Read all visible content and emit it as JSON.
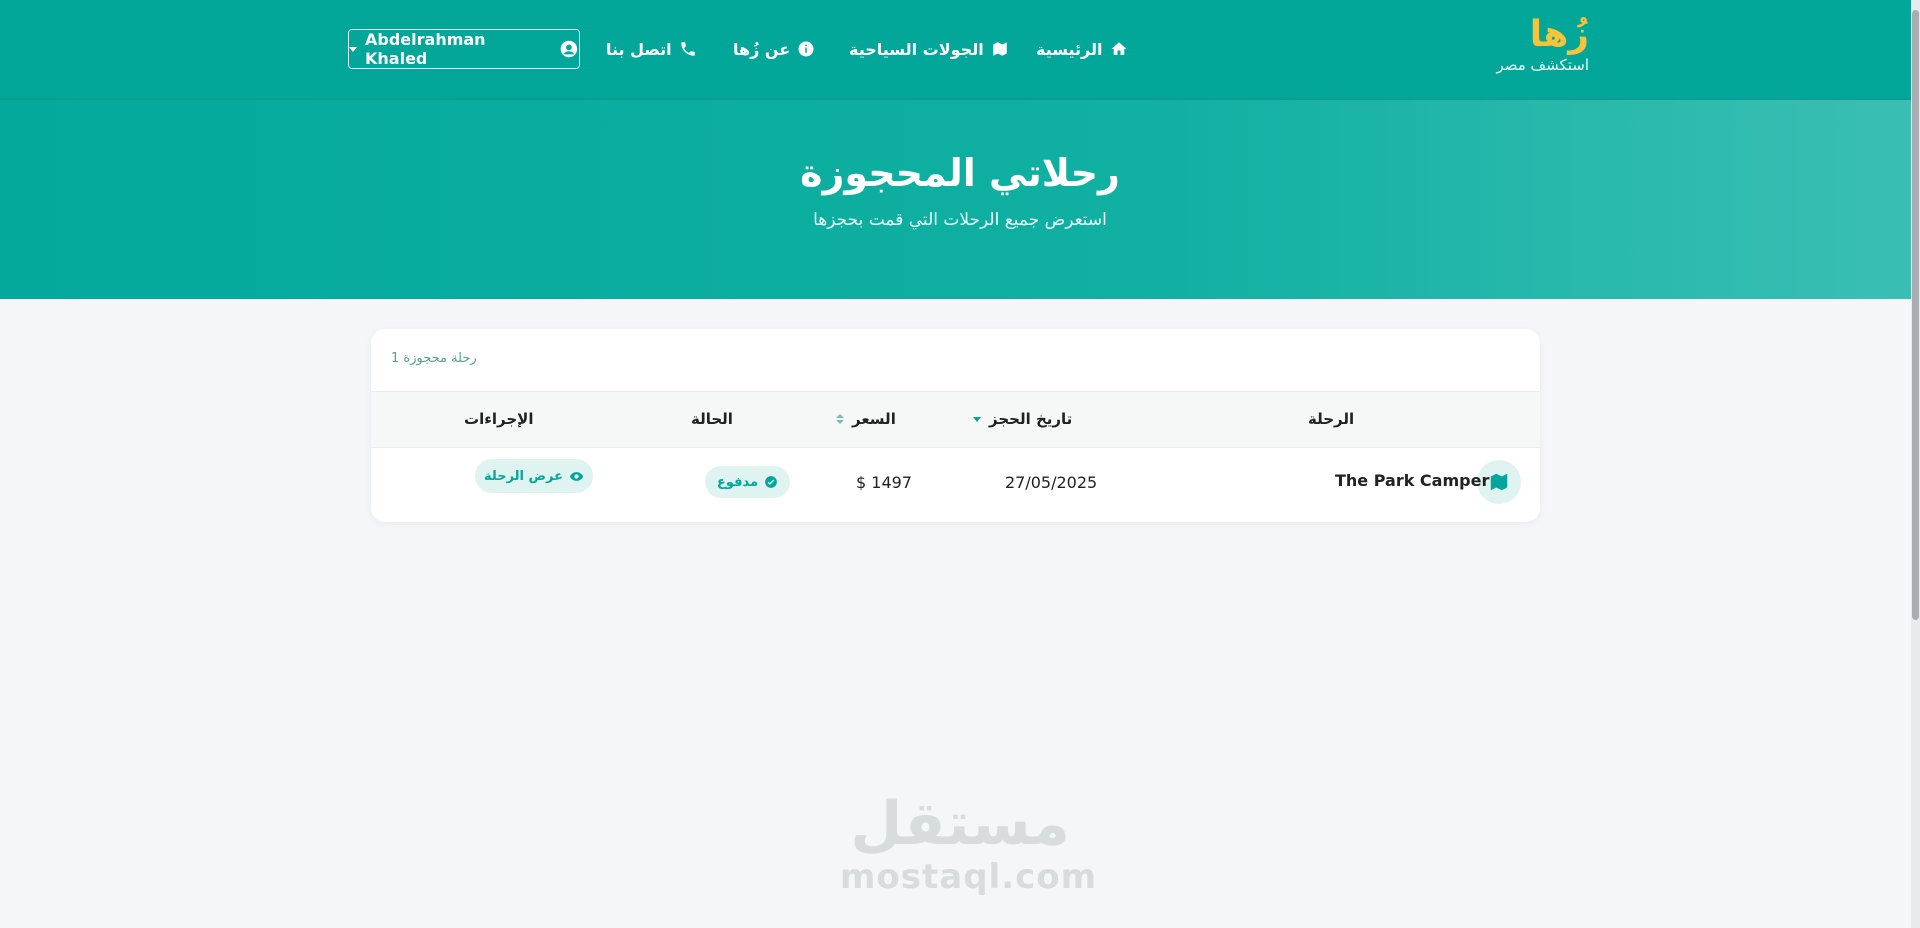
{
  "nav": {
    "brand_name": "زُها",
    "brand_tagline": "استكشف مصر",
    "home_label": "الرئيسية",
    "tours_label": "الجولات السياحية",
    "about_label": "عن زُها",
    "contact_label": "اتصل بنا",
    "user_name": "Abdelrahman Khaled"
  },
  "hero": {
    "title": "رحلاتي المحجوزة",
    "subtitle": "استعرض جميع الرحلات التي قمت بحجزها"
  },
  "bookings": {
    "count_text": "1 رحلة محجوزة",
    "columns": {
      "trip": "الرحلة",
      "booking_date": "تاريخ الحجز",
      "price": "السعر",
      "status": "الحالة",
      "actions": "الإجراءات"
    },
    "rows": [
      {
        "trip": "The Park Camper",
        "booking_date": "27/05/2025",
        "price": "$ 1497",
        "status": "مدفوع",
        "action": "عرض الرحلة"
      }
    ]
  },
  "watermark": {
    "arabic": "مستقل",
    "latin": "mostaql.com"
  },
  "colors": {
    "primary": "#02a79a",
    "brand_accent": "#f6c33a",
    "badge_bg": "#dff3f1",
    "page_bg": "#f4f6f9"
  },
  "icons": [
    "home-icon",
    "map-icon",
    "info-icon",
    "phone-icon",
    "user-circle-icon",
    "check-circle-icon",
    "eye-icon",
    "sort-icon"
  ]
}
